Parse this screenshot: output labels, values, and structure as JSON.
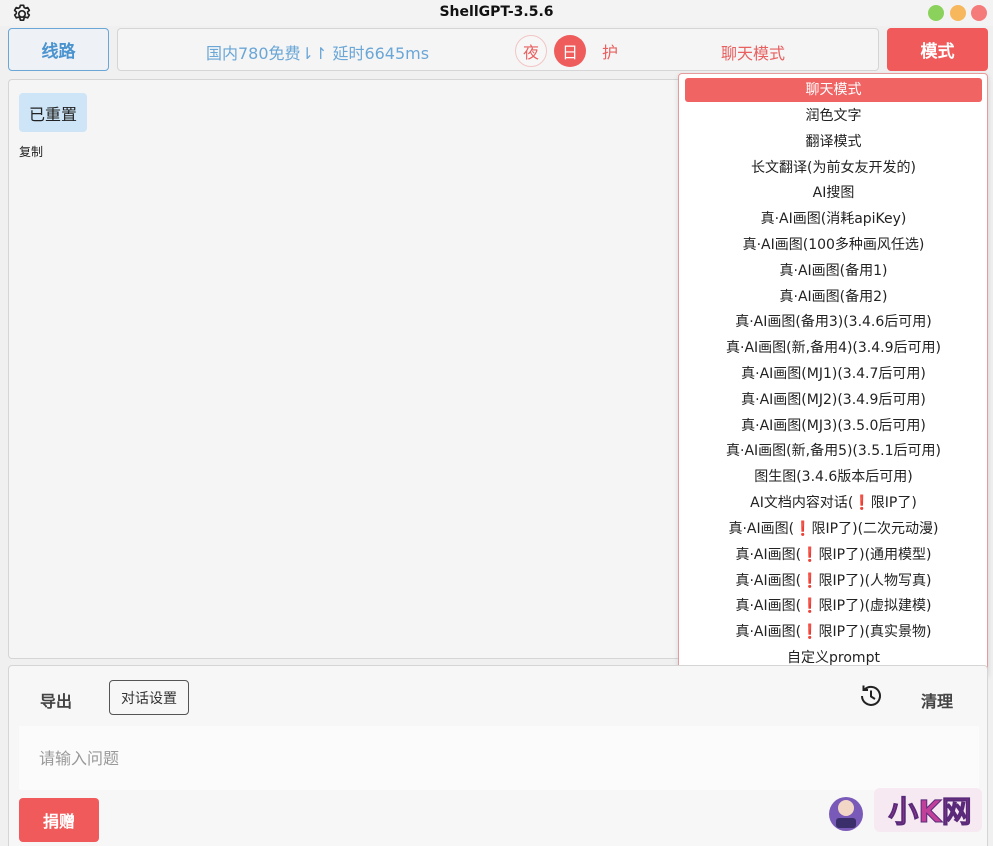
{
  "window": {
    "title": "ShellGPT-3.5.6"
  },
  "topbar": {
    "route_label": "线路",
    "status_text": "国内780免费⇂↾ 延时6645ms",
    "theme_night": "夜",
    "theme_day": "日",
    "theme_eye": "护",
    "current_mode": "聊天模式",
    "mode_button": "模式"
  },
  "chat": {
    "messages": [
      {
        "text": "已重置",
        "copy_label": "复制"
      }
    ]
  },
  "mode_menu": {
    "selected": "聊天模式",
    "items": [
      "聊天模式",
      "润色文字",
      "翻译模式",
      "长文翻译(为前女友开发的)",
      "AI搜图",
      "真·AI画图(消耗apiKey)",
      "真·AI画图(100多种画风任选)",
      "真·AI画图(备用1)",
      "真·AI画图(备用2)",
      "真·AI画图(备用3)(3.4.6后可用)",
      "真·AI画图(新,备用4)(3.4.9后可用)",
      "真·AI画图(MJ1)(3.4.7后可用)",
      "真·AI画图(MJ2)(3.4.9后可用)",
      "真·AI画图(MJ3)(3.5.0后可用)",
      "真·AI画图(新,备用5)(3.5.1后可用)",
      "图生图(3.4.6版本后可用)",
      "AI文档内容对话(❗限IP了)",
      "真·AI画图(❗限IP了)(二次元动漫)",
      "真·AI画图(❗限IP了)(通用模型)",
      "真·AI画图(❗限IP了)(人物写真)",
      "真·AI画图(❗限IP了)(虚拟建模)",
      "真·AI画图(❗限IP了)(真实景物)",
      "自定义prompt"
    ]
  },
  "bottom": {
    "export_label": "导出",
    "settings_label": "对话设置",
    "clear_label": "清理",
    "input_placeholder": "请输入问题",
    "donate_label": "捐赠"
  },
  "watermark": {
    "text": "小K网"
  },
  "colors": {
    "accent_red": "#f15a5a",
    "accent_blue": "#4a93cf",
    "bubble_blue": "#cde5f7"
  }
}
